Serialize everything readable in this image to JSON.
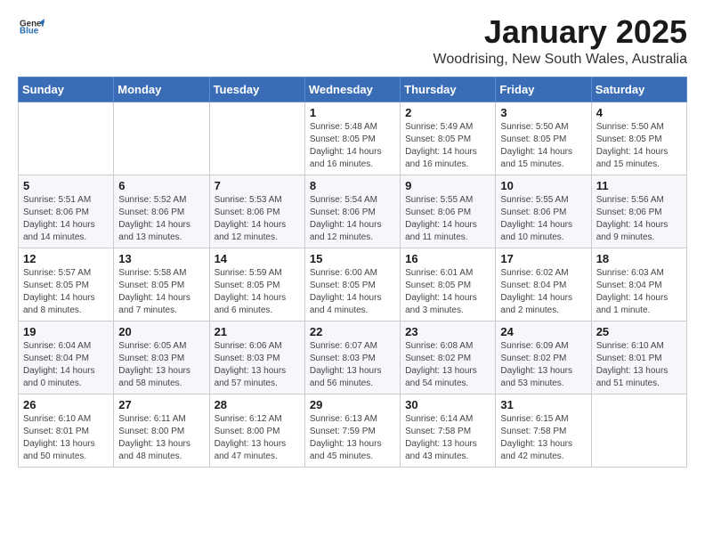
{
  "header": {
    "logo_line1": "General",
    "logo_line2": "Blue",
    "month_title": "January 2025",
    "location": "Woodrising, New South Wales, Australia"
  },
  "weekdays": [
    "Sunday",
    "Monday",
    "Tuesday",
    "Wednesday",
    "Thursday",
    "Friday",
    "Saturday"
  ],
  "weeks": [
    [
      {
        "day": null
      },
      {
        "day": null
      },
      {
        "day": null
      },
      {
        "day": "1",
        "sunrise": "Sunrise: 5:48 AM",
        "sunset": "Sunset: 8:05 PM",
        "daylight": "Daylight: 14 hours and 16 minutes."
      },
      {
        "day": "2",
        "sunrise": "Sunrise: 5:49 AM",
        "sunset": "Sunset: 8:05 PM",
        "daylight": "Daylight: 14 hours and 16 minutes."
      },
      {
        "day": "3",
        "sunrise": "Sunrise: 5:50 AM",
        "sunset": "Sunset: 8:05 PM",
        "daylight": "Daylight: 14 hours and 15 minutes."
      },
      {
        "day": "4",
        "sunrise": "Sunrise: 5:50 AM",
        "sunset": "Sunset: 8:05 PM",
        "daylight": "Daylight: 14 hours and 15 minutes."
      }
    ],
    [
      {
        "day": "5",
        "sunrise": "Sunrise: 5:51 AM",
        "sunset": "Sunset: 8:06 PM",
        "daylight": "Daylight: 14 hours and 14 minutes."
      },
      {
        "day": "6",
        "sunrise": "Sunrise: 5:52 AM",
        "sunset": "Sunset: 8:06 PM",
        "daylight": "Daylight: 14 hours and 13 minutes."
      },
      {
        "day": "7",
        "sunrise": "Sunrise: 5:53 AM",
        "sunset": "Sunset: 8:06 PM",
        "daylight": "Daylight: 14 hours and 12 minutes."
      },
      {
        "day": "8",
        "sunrise": "Sunrise: 5:54 AM",
        "sunset": "Sunset: 8:06 PM",
        "daylight": "Daylight: 14 hours and 12 minutes."
      },
      {
        "day": "9",
        "sunrise": "Sunrise: 5:55 AM",
        "sunset": "Sunset: 8:06 PM",
        "daylight": "Daylight: 14 hours and 11 minutes."
      },
      {
        "day": "10",
        "sunrise": "Sunrise: 5:55 AM",
        "sunset": "Sunset: 8:06 PM",
        "daylight": "Daylight: 14 hours and 10 minutes."
      },
      {
        "day": "11",
        "sunrise": "Sunrise: 5:56 AM",
        "sunset": "Sunset: 8:06 PM",
        "daylight": "Daylight: 14 hours and 9 minutes."
      }
    ],
    [
      {
        "day": "12",
        "sunrise": "Sunrise: 5:57 AM",
        "sunset": "Sunset: 8:05 PM",
        "daylight": "Daylight: 14 hours and 8 minutes."
      },
      {
        "day": "13",
        "sunrise": "Sunrise: 5:58 AM",
        "sunset": "Sunset: 8:05 PM",
        "daylight": "Daylight: 14 hours and 7 minutes."
      },
      {
        "day": "14",
        "sunrise": "Sunrise: 5:59 AM",
        "sunset": "Sunset: 8:05 PM",
        "daylight": "Daylight: 14 hours and 6 minutes."
      },
      {
        "day": "15",
        "sunrise": "Sunrise: 6:00 AM",
        "sunset": "Sunset: 8:05 PM",
        "daylight": "Daylight: 14 hours and 4 minutes."
      },
      {
        "day": "16",
        "sunrise": "Sunrise: 6:01 AM",
        "sunset": "Sunset: 8:05 PM",
        "daylight": "Daylight: 14 hours and 3 minutes."
      },
      {
        "day": "17",
        "sunrise": "Sunrise: 6:02 AM",
        "sunset": "Sunset: 8:04 PM",
        "daylight": "Daylight: 14 hours and 2 minutes."
      },
      {
        "day": "18",
        "sunrise": "Sunrise: 6:03 AM",
        "sunset": "Sunset: 8:04 PM",
        "daylight": "Daylight: 14 hours and 1 minute."
      }
    ],
    [
      {
        "day": "19",
        "sunrise": "Sunrise: 6:04 AM",
        "sunset": "Sunset: 8:04 PM",
        "daylight": "Daylight: 14 hours and 0 minutes."
      },
      {
        "day": "20",
        "sunrise": "Sunrise: 6:05 AM",
        "sunset": "Sunset: 8:03 PM",
        "daylight": "Daylight: 13 hours and 58 minutes."
      },
      {
        "day": "21",
        "sunrise": "Sunrise: 6:06 AM",
        "sunset": "Sunset: 8:03 PM",
        "daylight": "Daylight: 13 hours and 57 minutes."
      },
      {
        "day": "22",
        "sunrise": "Sunrise: 6:07 AM",
        "sunset": "Sunset: 8:03 PM",
        "daylight": "Daylight: 13 hours and 56 minutes."
      },
      {
        "day": "23",
        "sunrise": "Sunrise: 6:08 AM",
        "sunset": "Sunset: 8:02 PM",
        "daylight": "Daylight: 13 hours and 54 minutes."
      },
      {
        "day": "24",
        "sunrise": "Sunrise: 6:09 AM",
        "sunset": "Sunset: 8:02 PM",
        "daylight": "Daylight: 13 hours and 53 minutes."
      },
      {
        "day": "25",
        "sunrise": "Sunrise: 6:10 AM",
        "sunset": "Sunset: 8:01 PM",
        "daylight": "Daylight: 13 hours and 51 minutes."
      }
    ],
    [
      {
        "day": "26",
        "sunrise": "Sunrise: 6:10 AM",
        "sunset": "Sunset: 8:01 PM",
        "daylight": "Daylight: 13 hours and 50 minutes."
      },
      {
        "day": "27",
        "sunrise": "Sunrise: 6:11 AM",
        "sunset": "Sunset: 8:00 PM",
        "daylight": "Daylight: 13 hours and 48 minutes."
      },
      {
        "day": "28",
        "sunrise": "Sunrise: 6:12 AM",
        "sunset": "Sunset: 8:00 PM",
        "daylight": "Daylight: 13 hours and 47 minutes."
      },
      {
        "day": "29",
        "sunrise": "Sunrise: 6:13 AM",
        "sunset": "Sunset: 7:59 PM",
        "daylight": "Daylight: 13 hours and 45 minutes."
      },
      {
        "day": "30",
        "sunrise": "Sunrise: 6:14 AM",
        "sunset": "Sunset: 7:58 PM",
        "daylight": "Daylight: 13 hours and 43 minutes."
      },
      {
        "day": "31",
        "sunrise": "Sunrise: 6:15 AM",
        "sunset": "Sunset: 7:58 PM",
        "daylight": "Daylight: 13 hours and 42 minutes."
      },
      {
        "day": null
      }
    ]
  ]
}
